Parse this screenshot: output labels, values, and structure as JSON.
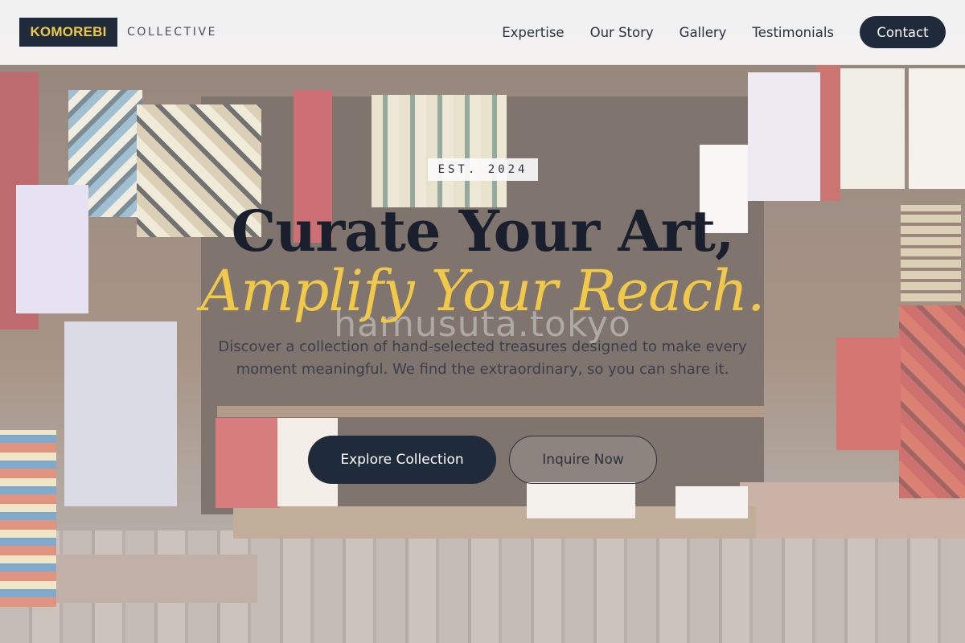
{
  "header": {
    "logo_text": "KOMOREBI",
    "logo_sub": "COLLECTIVE",
    "nav": [
      {
        "label": "Expertise"
      },
      {
        "label": "Our Story"
      },
      {
        "label": "Gallery"
      },
      {
        "label": "Testimonials"
      }
    ],
    "contact_label": "Contact"
  },
  "hero": {
    "badge": "EST. 2024",
    "headline": "Curate Your Art,",
    "headline_accent": "Amplify Your Reach.",
    "subtext": "Discover a collection of hand-selected treasures designed to make every moment meaningful. We find the extraordinary, so you can share it.",
    "primary_cta": "Explore Collection",
    "secondary_cta": "Inquire Now",
    "background_watermark": "hamusuta.tokyo"
  },
  "colors": {
    "brand_dark": "#1f2a3b",
    "brand_accent": "#f1c94a"
  }
}
